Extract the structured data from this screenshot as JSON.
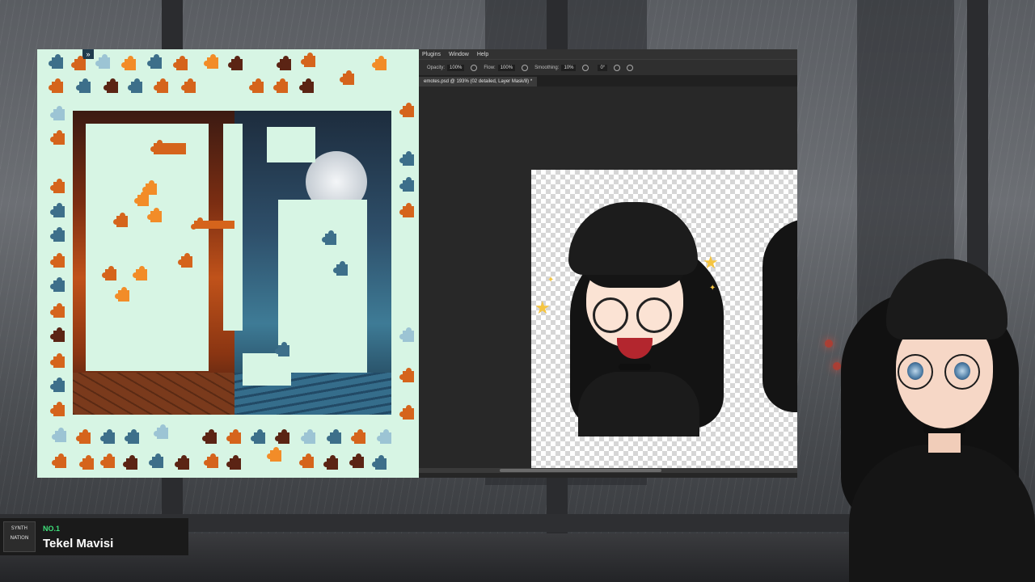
{
  "puzzle": {
    "collapse_icon": "chevron-double-down-icon"
  },
  "photoshop": {
    "menu": [
      "Plugins",
      "Window",
      "Help"
    ],
    "options": [
      {
        "label": "Opacity:",
        "value": "100%"
      },
      {
        "label": "Flow:",
        "value": "100%"
      },
      {
        "label": "Smoothing:",
        "value": "10%"
      },
      {
        "label": "",
        "value": "0°"
      }
    ],
    "tab_label": "emotes.psd @ 193% (02 detailed, Layer Mask/8) *"
  },
  "nameplate": {
    "logo_text": "SYNTH NATION",
    "rank": "NO.1",
    "name": "Tekel Mavisi"
  },
  "colors": {
    "puzzle_bg": "#d7f5e4",
    "rank_green": "#3ee07a",
    "ps_dark": "#262626"
  }
}
